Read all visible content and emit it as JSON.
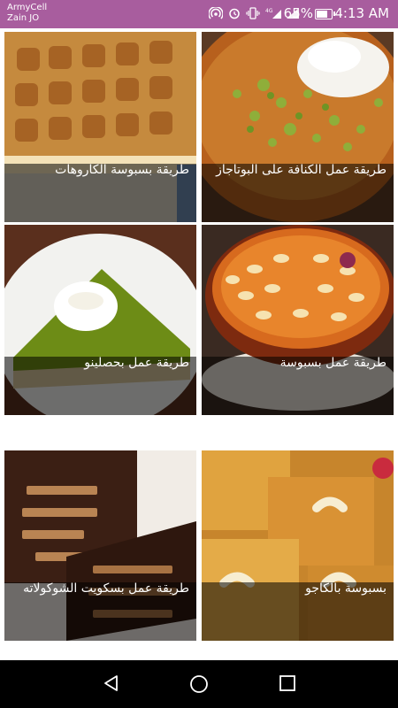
{
  "status_bar": {
    "carrier_line1": "ArmyCell",
    "carrier_line2": "Zain JO",
    "battery_percent": "65%",
    "battery_level": 0.65,
    "time": "4:13 AM",
    "icons": [
      "hotspot-icon",
      "alarm-icon",
      "vibrate-icon",
      "signal-4g-icon",
      "signal-icon",
      "battery-icon"
    ]
  },
  "recipes": [
    {
      "title": "طريقة عمل الكنافة على البوتاجاز"
    },
    {
      "title": "طريقة بسبوسة الكاروهات"
    },
    {
      "title": "طريقة عمل بسبوسة"
    },
    {
      "title": "طريقة عمل بحصلينو"
    },
    {
      "title": "بسبوسة بالكاجو"
    },
    {
      "title": "طريقة عمل بسكويت الشوكولاته"
    }
  ],
  "colors": {
    "status_bar": "#a85d9e",
    "caption_overlay": "rgba(0,0,0,0.55)",
    "nav_bar": "#000000"
  },
  "nav_bar": {
    "icons": [
      "back-icon",
      "home-icon",
      "recents-icon"
    ]
  }
}
